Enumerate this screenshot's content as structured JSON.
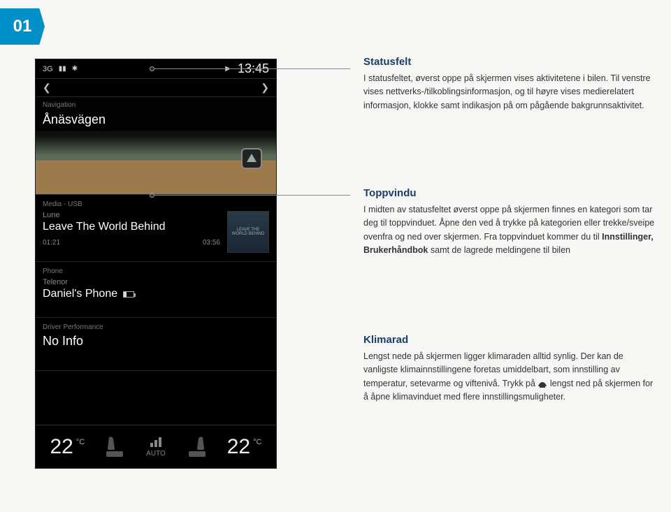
{
  "page_number": "01",
  "device": {
    "status_bar": {
      "network": "3G",
      "signal_icon": "signal-bars",
      "bluetooth": "✱",
      "play_icon": "▶",
      "clock": "13:45"
    },
    "navigation": {
      "label": "Navigation",
      "title": "Ånäsvägen"
    },
    "media": {
      "label": "Media - USB",
      "artist": "Lune",
      "track": "Leave The World Behind",
      "elapsed": "01:21",
      "total": "03:56",
      "cover_text": "LEAVE THE WORLD BEHIND"
    },
    "phone": {
      "label": "Phone",
      "operator": "Telenor",
      "device_name": "Daniel's Phone"
    },
    "performance": {
      "label": "Driver Performance",
      "value": "No Info"
    },
    "climate": {
      "temp_left": "22",
      "temp_right": "22",
      "unit": "°C",
      "auto_label": "AUTO"
    }
  },
  "sections": {
    "status": {
      "title": "Statusfelt",
      "body": "I statusfeltet, øverst oppe på skjermen vises aktivitetene i bilen. Til venstre vises nettverks-/tilkoblingsinformasjon, og til høyre vises medierelatert informasjon, klokke samt indikasjon på om pågående bakgrunnsaktivitet."
    },
    "top": {
      "title": "Toppvindu",
      "body_1": "I midten av statusfeltet øverst oppe på skjermen finnes en kategori som tar deg til toppvinduet. Åpne den ved å trykke på kategorien eller trekke/sveipe ovenfra og ned over skjermen. Fra toppvinduet kommer du til ",
      "bold_1": "Innstillinger, Brukerhåndbok",
      "body_2": " samt de lagrede meldingene til bilen"
    },
    "climate": {
      "title": "Klimarad",
      "body_1": "Lengst nede på skjermen ligger klimaraden alltid synlig. Der kan de vanligste klimainnstillingene foretas umiddelbart, som innstilling av temperatur, setevarme og viftenivå. Trykk på ",
      "body_2": " lengst ned på skjermen for å åpne klimavinduet med flere innstillingsmuligheter."
    }
  }
}
